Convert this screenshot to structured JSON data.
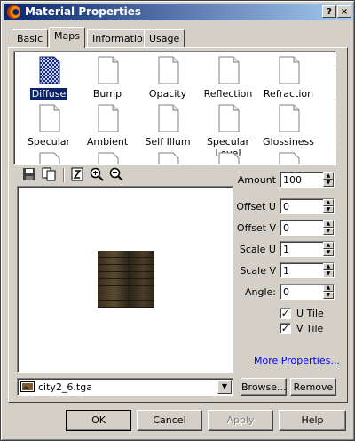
{
  "window": {
    "title": "Material Properties",
    "help_btn": "?",
    "close_btn": "×"
  },
  "tabs": [
    "Basic",
    "Maps",
    "Information",
    "Usage"
  ],
  "maps": {
    "row1": [
      "Diffuse",
      "Bump",
      "Opacity",
      "Reflection",
      "Refraction"
    ],
    "row2": [
      "Specular",
      "Ambient",
      "Self Illum",
      "Specular Level",
      "Glossiness"
    ],
    "selected": "Diffuse"
  },
  "params": {
    "amount_label": "Amount",
    "amount": "100",
    "offset_u_label": "Offset U",
    "offset_u": "0",
    "offset_v_label": "Offset V",
    "offset_v": "0",
    "scale_u_label": "Scale U",
    "scale_u": "1",
    "scale_v_label": "Scale V",
    "scale_v": "1",
    "angle_label": "Angle:",
    "angle": "0"
  },
  "tiling": {
    "u_tile_label": "U Tile",
    "u_tile_checked": true,
    "v_tile_label": "V Tile",
    "v_tile_checked": true
  },
  "links": {
    "more_properties": "More Properties..."
  },
  "file": {
    "name": "city2_6.tga",
    "browse": "Browse...",
    "remove": "Remove"
  },
  "footer": {
    "ok": "OK",
    "cancel": "Cancel",
    "apply": "Apply",
    "help": "Help"
  }
}
